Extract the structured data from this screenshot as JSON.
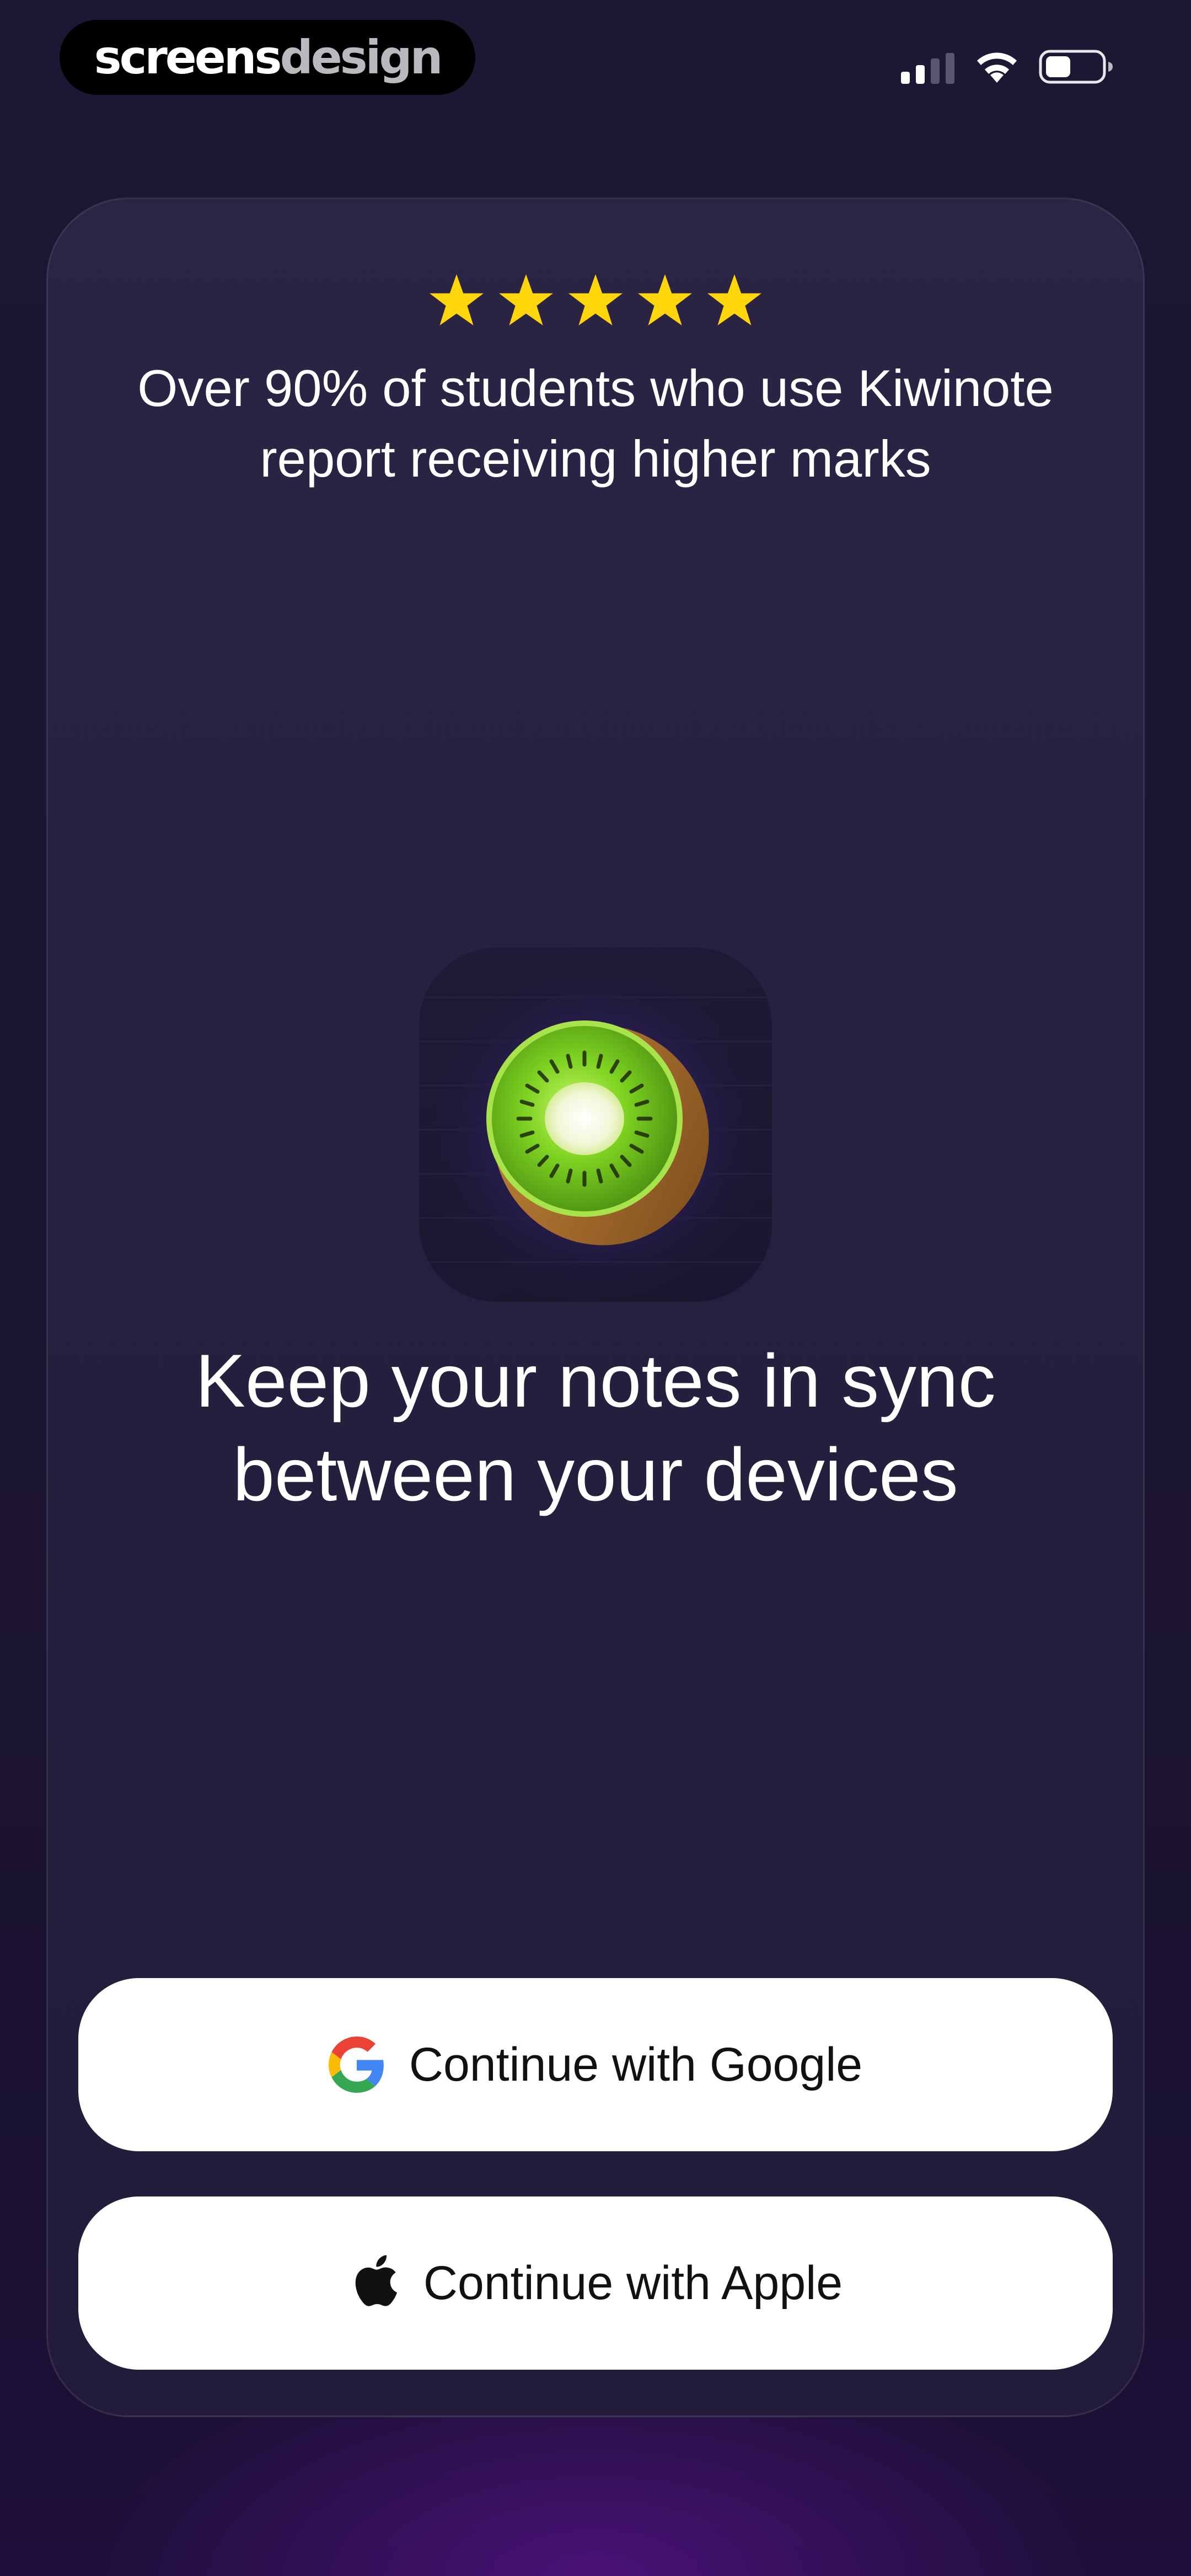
{
  "status_bar": {
    "watermark": {
      "part1": "screens",
      "part2": "design"
    },
    "icons": [
      "cellular-signal-icon",
      "wifi-icon",
      "battery-icon"
    ]
  },
  "rating": {
    "star_count": 5,
    "star_color": "#FFD60A",
    "text": "Over 90% of students who use Kiwinote report receiving higher marks"
  },
  "feature": {
    "app_icon": "kiwi-icon",
    "headline": "Keep your notes in sync between your devices"
  },
  "auth": {
    "google_label": "Continue with Google",
    "apple_label": "Continue with Apple"
  },
  "colors": {
    "background": "#1C1530",
    "card": "#272041",
    "button": "#FFFFFF",
    "button_text": "#111111",
    "kiwi_flesh": "#7ED321"
  }
}
